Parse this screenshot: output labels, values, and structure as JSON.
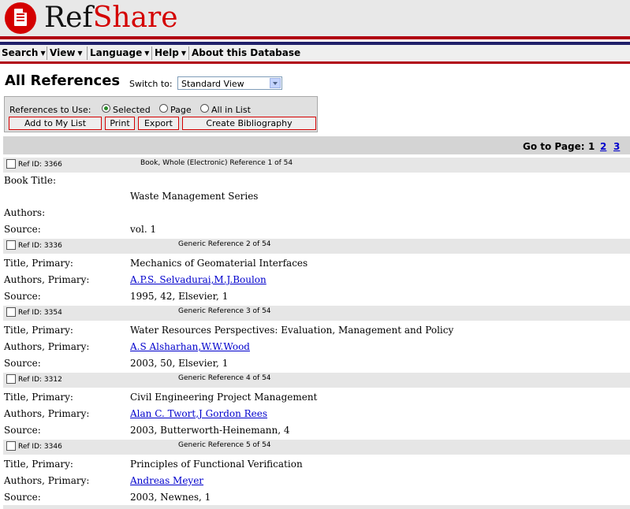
{
  "app": {
    "logo_ref": "Ref",
    "logo_share": "Share"
  },
  "menu": {
    "search": "Search",
    "view": "View",
    "language": "Language",
    "help": "Help",
    "about": "About this Database"
  },
  "page": {
    "title": "All References",
    "switch_label": "Switch to:",
    "view_selected": "Standard View"
  },
  "options": {
    "refs_to_use_label": "References to Use:",
    "radio_selected": "Selected",
    "radio_page": "Page",
    "radio_all": "All in List",
    "selected_option": "Selected",
    "add_to_list": "Add to My List",
    "print": "Print",
    "export": "Export",
    "create_bibliography": "Create Bibliography"
  },
  "pager": {
    "label": "Go to Page:",
    "current": "1",
    "p2": "2",
    "p3": "3"
  },
  "refs": [
    {
      "id": "Ref ID: 3366",
      "type": "Book, Whole (Electronic) Reference 1 of 54",
      "label1": "Book Title:",
      "value1": "Waste Management Series",
      "label2": "Authors:",
      "value2": "",
      "label3": "Source:",
      "value3": "vol. 1"
    },
    {
      "id": "Ref ID: 3336",
      "type": "Generic Reference 2 of 54",
      "label1": "Title, Primary:",
      "value1": "Mechanics of Geomaterial Interfaces",
      "label2": "Authors, Primary:",
      "value2": "A.P.S. Selvadurai,M.J.Boulon",
      "label3": "Source:",
      "value3": "1995, 42, Elsevier, 1"
    },
    {
      "id": "Ref ID: 3354",
      "type": "Generic Reference 3 of 54",
      "label1": "Title, Primary:",
      "value1": "Water Resources Perspectives: Evaluation, Management and Policy",
      "label2": "Authors, Primary:",
      "value2": "A.S Alsharhan,W.W.Wood",
      "label3": "Source:",
      "value3": "2003, 50, Elsevier, 1"
    },
    {
      "id": "Ref ID: 3312",
      "type": "Generic Reference 4 of 54",
      "label1": "Title, Primary:",
      "value1": "Civil Engineering Project Management",
      "label2": "Authors, Primary:",
      "value2": "Alan C. Twort,J Gordon Rees",
      "label3": "Source:",
      "value3": "2003, Butterworth-Heinemann, 4"
    },
    {
      "id": "Ref ID: 3346",
      "type": "Generic Reference 5 of 54",
      "label1": "Title, Primary:",
      "value1": "Principles of Functional Verification",
      "label2": "Authors, Primary:",
      "value2": "Andreas Meyer",
      "label3": "Source:",
      "value3": "2003, Newnes, 1"
    }
  ],
  "colors": {
    "brand_red": "#d40000",
    "navy": "#20206a",
    "link": "#0000cc"
  }
}
